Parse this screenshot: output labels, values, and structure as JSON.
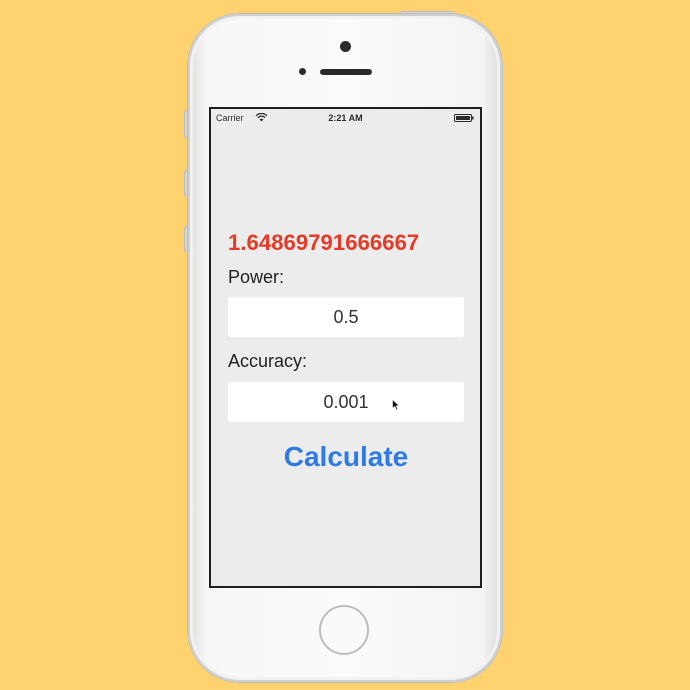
{
  "status_bar": {
    "carrier": "Carrier",
    "time": "2:21 AM",
    "wifi_icon": "wifi-icon",
    "battery_icon": "battery-icon"
  },
  "result": {
    "value": "1.64869791666667",
    "color": "#e53a25"
  },
  "power": {
    "label": "Power:",
    "value": "0.5"
  },
  "accuracy": {
    "label": "Accuracy:",
    "value": "0.001"
  },
  "calculate_button": {
    "label": "Calculate",
    "color": "#2f7ae5"
  },
  "colors": {
    "background": "#fed26f",
    "screen": "#ececec"
  }
}
